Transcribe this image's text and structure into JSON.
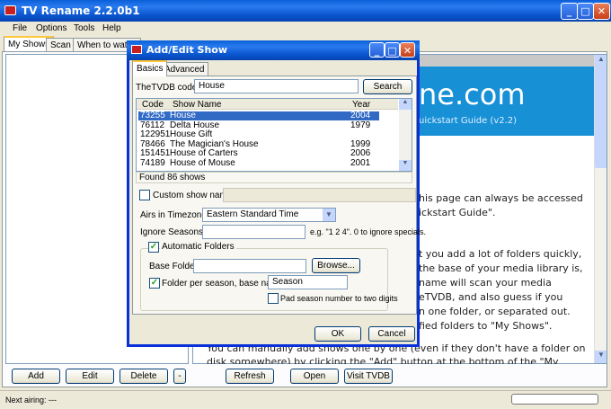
{
  "main": {
    "title": "TV Rename 2.2.0b1",
    "menu": [
      "File",
      "Options",
      "Tools",
      "Help"
    ],
    "tabs": [
      "My Shows",
      "Scan",
      "When to watch"
    ],
    "buttons": {
      "add": "Add",
      "edit": "Edit",
      "delete": "Delete",
      "dash": "-",
      "refresh": "Refresh",
      "open": "Open",
      "visit": "Visit TVDB"
    },
    "status": "Next airing: ---",
    "web": {
      "header_title": "ne.com",
      "header_sub": "uickstart Guide (v2.2)",
      "lines": [
        "his page can always be accessed",
        "ickstart Guide\".",
        "t you add a lot of folders quickly,",
        "the base of your media library is,",
        "name will scan your media",
        "eTVDB, and also guess if you",
        "n one folder, or separated out.",
        "fied folders to \"My Shows\"."
      ],
      "lines_bottom": [
        "You can manually add shows one by one (even if they don't have a folder on",
        "disk somewhere) by clicking the \"Add\" button at the bottom of the \"My"
      ]
    }
  },
  "dialog": {
    "title": "Add/Edit Show",
    "tabs": [
      "Basics",
      "Advanced"
    ],
    "code_label": "TheTVDB code:",
    "code_value": "House",
    "search": "Search",
    "columns": [
      "Code",
      "Show Name",
      "Year"
    ],
    "rows": [
      {
        "code": "73255",
        "name": "House",
        "year": "2004"
      },
      {
        "code": "76112",
        "name": "Delta House",
        "year": "1979"
      },
      {
        "code": "122951",
        "name": "House Gift",
        "year": ""
      },
      {
        "code": "78466",
        "name": "The Magician's House",
        "year": "1999"
      },
      {
        "code": "151451",
        "name": "House of Carters",
        "year": "2006"
      },
      {
        "code": "74189",
        "name": "House of Mouse",
        "year": "2001"
      }
    ],
    "found": "Found 86 shows",
    "custom_name": "Custom show name:",
    "tz_label": "Airs in Timezone:",
    "tz_value": "Eastern Standard Time",
    "ignore_label": "Ignore Seasons:",
    "ignore_hint": "e.g. \"1 2 4\". 0 to ignore specials.",
    "auto_folders": "Automatic Folders",
    "base_folder": "Base Folder",
    "browse": "Browse...",
    "folder_per_season": "Folder per season, base name:",
    "season_value": "Season",
    "pad": "Pad season number to two digits",
    "ok": "OK",
    "cancel": "Cancel"
  }
}
